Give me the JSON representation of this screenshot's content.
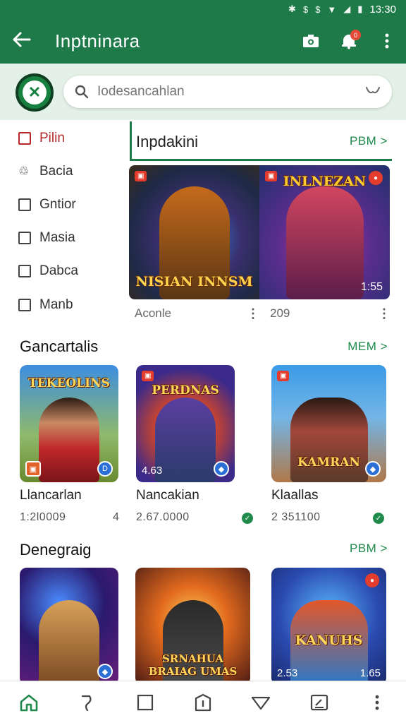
{
  "status": {
    "time": "13:30"
  },
  "appbar": {
    "title": "Inptninara",
    "notification_count": "0"
  },
  "search": {
    "placeholder": "Iodesancahlan"
  },
  "sidebar": {
    "items": [
      {
        "label": "Pilin",
        "active": true
      },
      {
        "label": "Bacia",
        "active": false
      },
      {
        "label": "Gntior",
        "active": false
      },
      {
        "label": "Masia",
        "active": false
      },
      {
        "label": "Dabca",
        "active": false
      },
      {
        "label": "Manb",
        "active": false
      }
    ]
  },
  "featured": {
    "title": "Inpdakini",
    "more": "PBM >",
    "banners": [
      {
        "text": "NISIAN INNSM",
        "meta": "Aconle"
      },
      {
        "text": "INLNEZAN",
        "num": "1:55",
        "meta": "209"
      }
    ]
  },
  "sections": [
    {
      "title": "Gancartalis",
      "more": "MEM >",
      "cards": [
        {
          "art": "TEKEOLINS",
          "title": "Llancarlan",
          "sub": "1:2l0009",
          "count": "4"
        },
        {
          "art": "PERDNAS",
          "num": "4.63",
          "title": "Nancakian",
          "sub": "2.67.0000"
        },
        {
          "art": "KAMRAN",
          "title": "Klaallas",
          "sub": "2 351100"
        }
      ]
    },
    {
      "title": "Denegraig",
      "more": "PBM >",
      "cards": [
        {
          "art": ""
        },
        {
          "art": "SRNAHUA BRAIAG UMAS"
        },
        {
          "art": "KANUHS",
          "num": "2.53",
          "num2": "1.65"
        }
      ]
    }
  ],
  "colors": {
    "primary": "#1f7a4a",
    "accent_link": "#1f8a4c",
    "active_item": "#b22a2a",
    "search_band": "#e4f1e8"
  }
}
